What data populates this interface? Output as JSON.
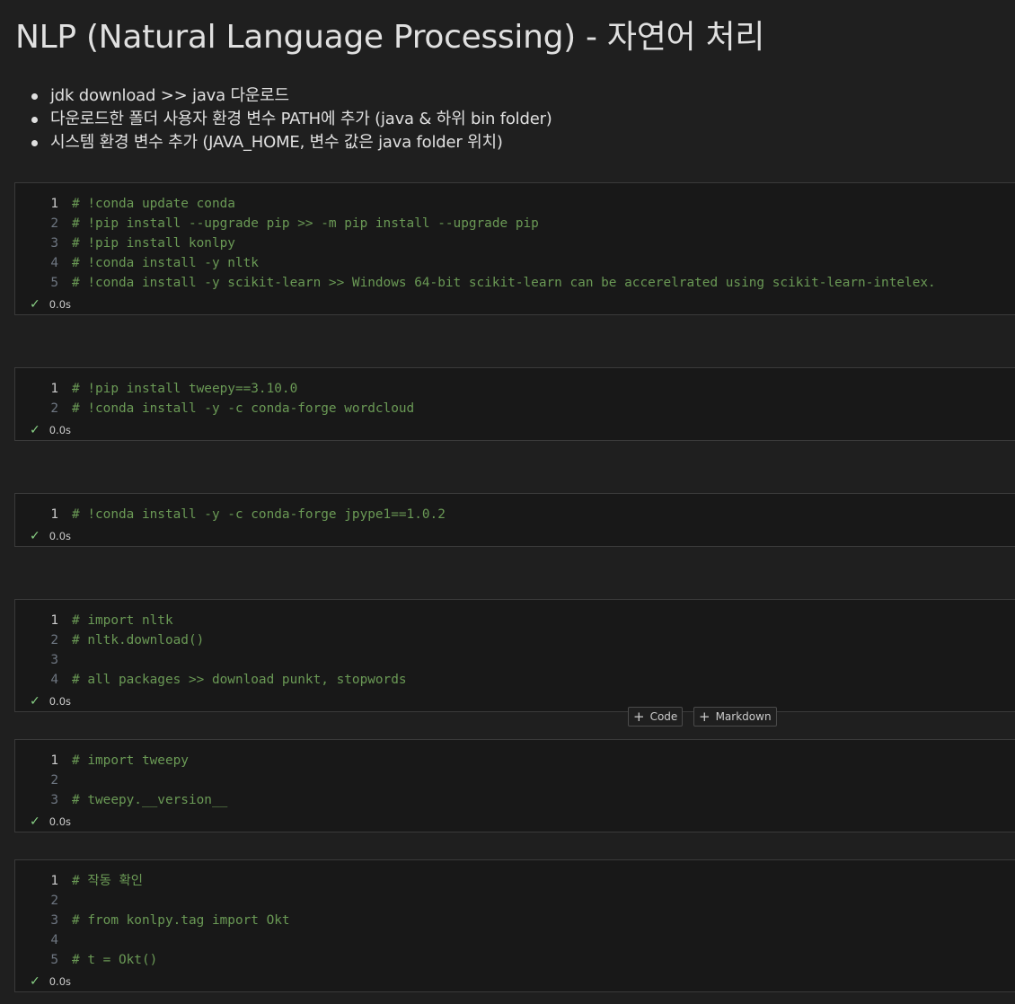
{
  "markdown": {
    "title": "NLP (Natural Language Processing) - 자연어 처리",
    "bullets": [
      "jdk download >> java 다운로드",
      "다운로드한 폴더 사용자 환경 변수 PATH에 추가 (java & 하위 bin folder)",
      "시스템 환경 변수 추가 (JAVA_HOME, 변수 값은 java folder 위치)"
    ]
  },
  "cells": [
    {
      "lines": [
        {
          "n": "1",
          "code": "# !conda update conda"
        },
        {
          "n": "2",
          "code": "# !pip install --upgrade pip >> -m pip install --upgrade pip"
        },
        {
          "n": "3",
          "code": "# !pip install konlpy"
        },
        {
          "n": "4",
          "code": "# !conda install -y nltk"
        },
        {
          "n": "5",
          "code": "# !conda install -y scikit-learn >> Windows 64-bit scikit-learn can be accerelrated using scikit-learn-intelex."
        }
      ],
      "status": "0.0s"
    },
    {
      "lines": [
        {
          "n": "1",
          "code": "# !pip install tweepy==3.10.0"
        },
        {
          "n": "2",
          "code": "# !conda install -y -c conda-forge wordcloud"
        }
      ],
      "status": "0.0s"
    },
    {
      "lines": [
        {
          "n": "1",
          "code": "# !conda install -y -c conda-forge jpype1==1.0.2"
        }
      ],
      "status": "0.0s"
    },
    {
      "lines": [
        {
          "n": "1",
          "code": "# import nltk"
        },
        {
          "n": "2",
          "code": "# nltk.download()"
        },
        {
          "n": "3",
          "code": ""
        },
        {
          "n": "4",
          "code": "# all packages >> download punkt, stopwords"
        }
      ],
      "status": "0.0s"
    },
    {
      "lines": [
        {
          "n": "1",
          "code": "# import tweepy"
        },
        {
          "n": "2",
          "code": ""
        },
        {
          "n": "3",
          "code": "# tweepy.__version__"
        }
      ],
      "status": "0.0s"
    },
    {
      "lines": [
        {
          "n": "1",
          "code": "# 작동 확인"
        },
        {
          "n": "2",
          "code": ""
        },
        {
          "n": "3",
          "code": "# from konlpy.tag import Okt"
        },
        {
          "n": "4",
          "code": ""
        },
        {
          "n": "5",
          "code": "# t = Okt()"
        }
      ],
      "status": "0.0s"
    }
  ],
  "toolbar": {
    "add_code_label": "Code",
    "add_markdown_label": "Markdown"
  },
  "icons": {
    "check": "check-icon",
    "plus": "plus-icon"
  },
  "colors": {
    "comment": "#6a9955",
    "success": "#89d185",
    "background": "#1f1f1f",
    "cell_background": "#181818"
  }
}
